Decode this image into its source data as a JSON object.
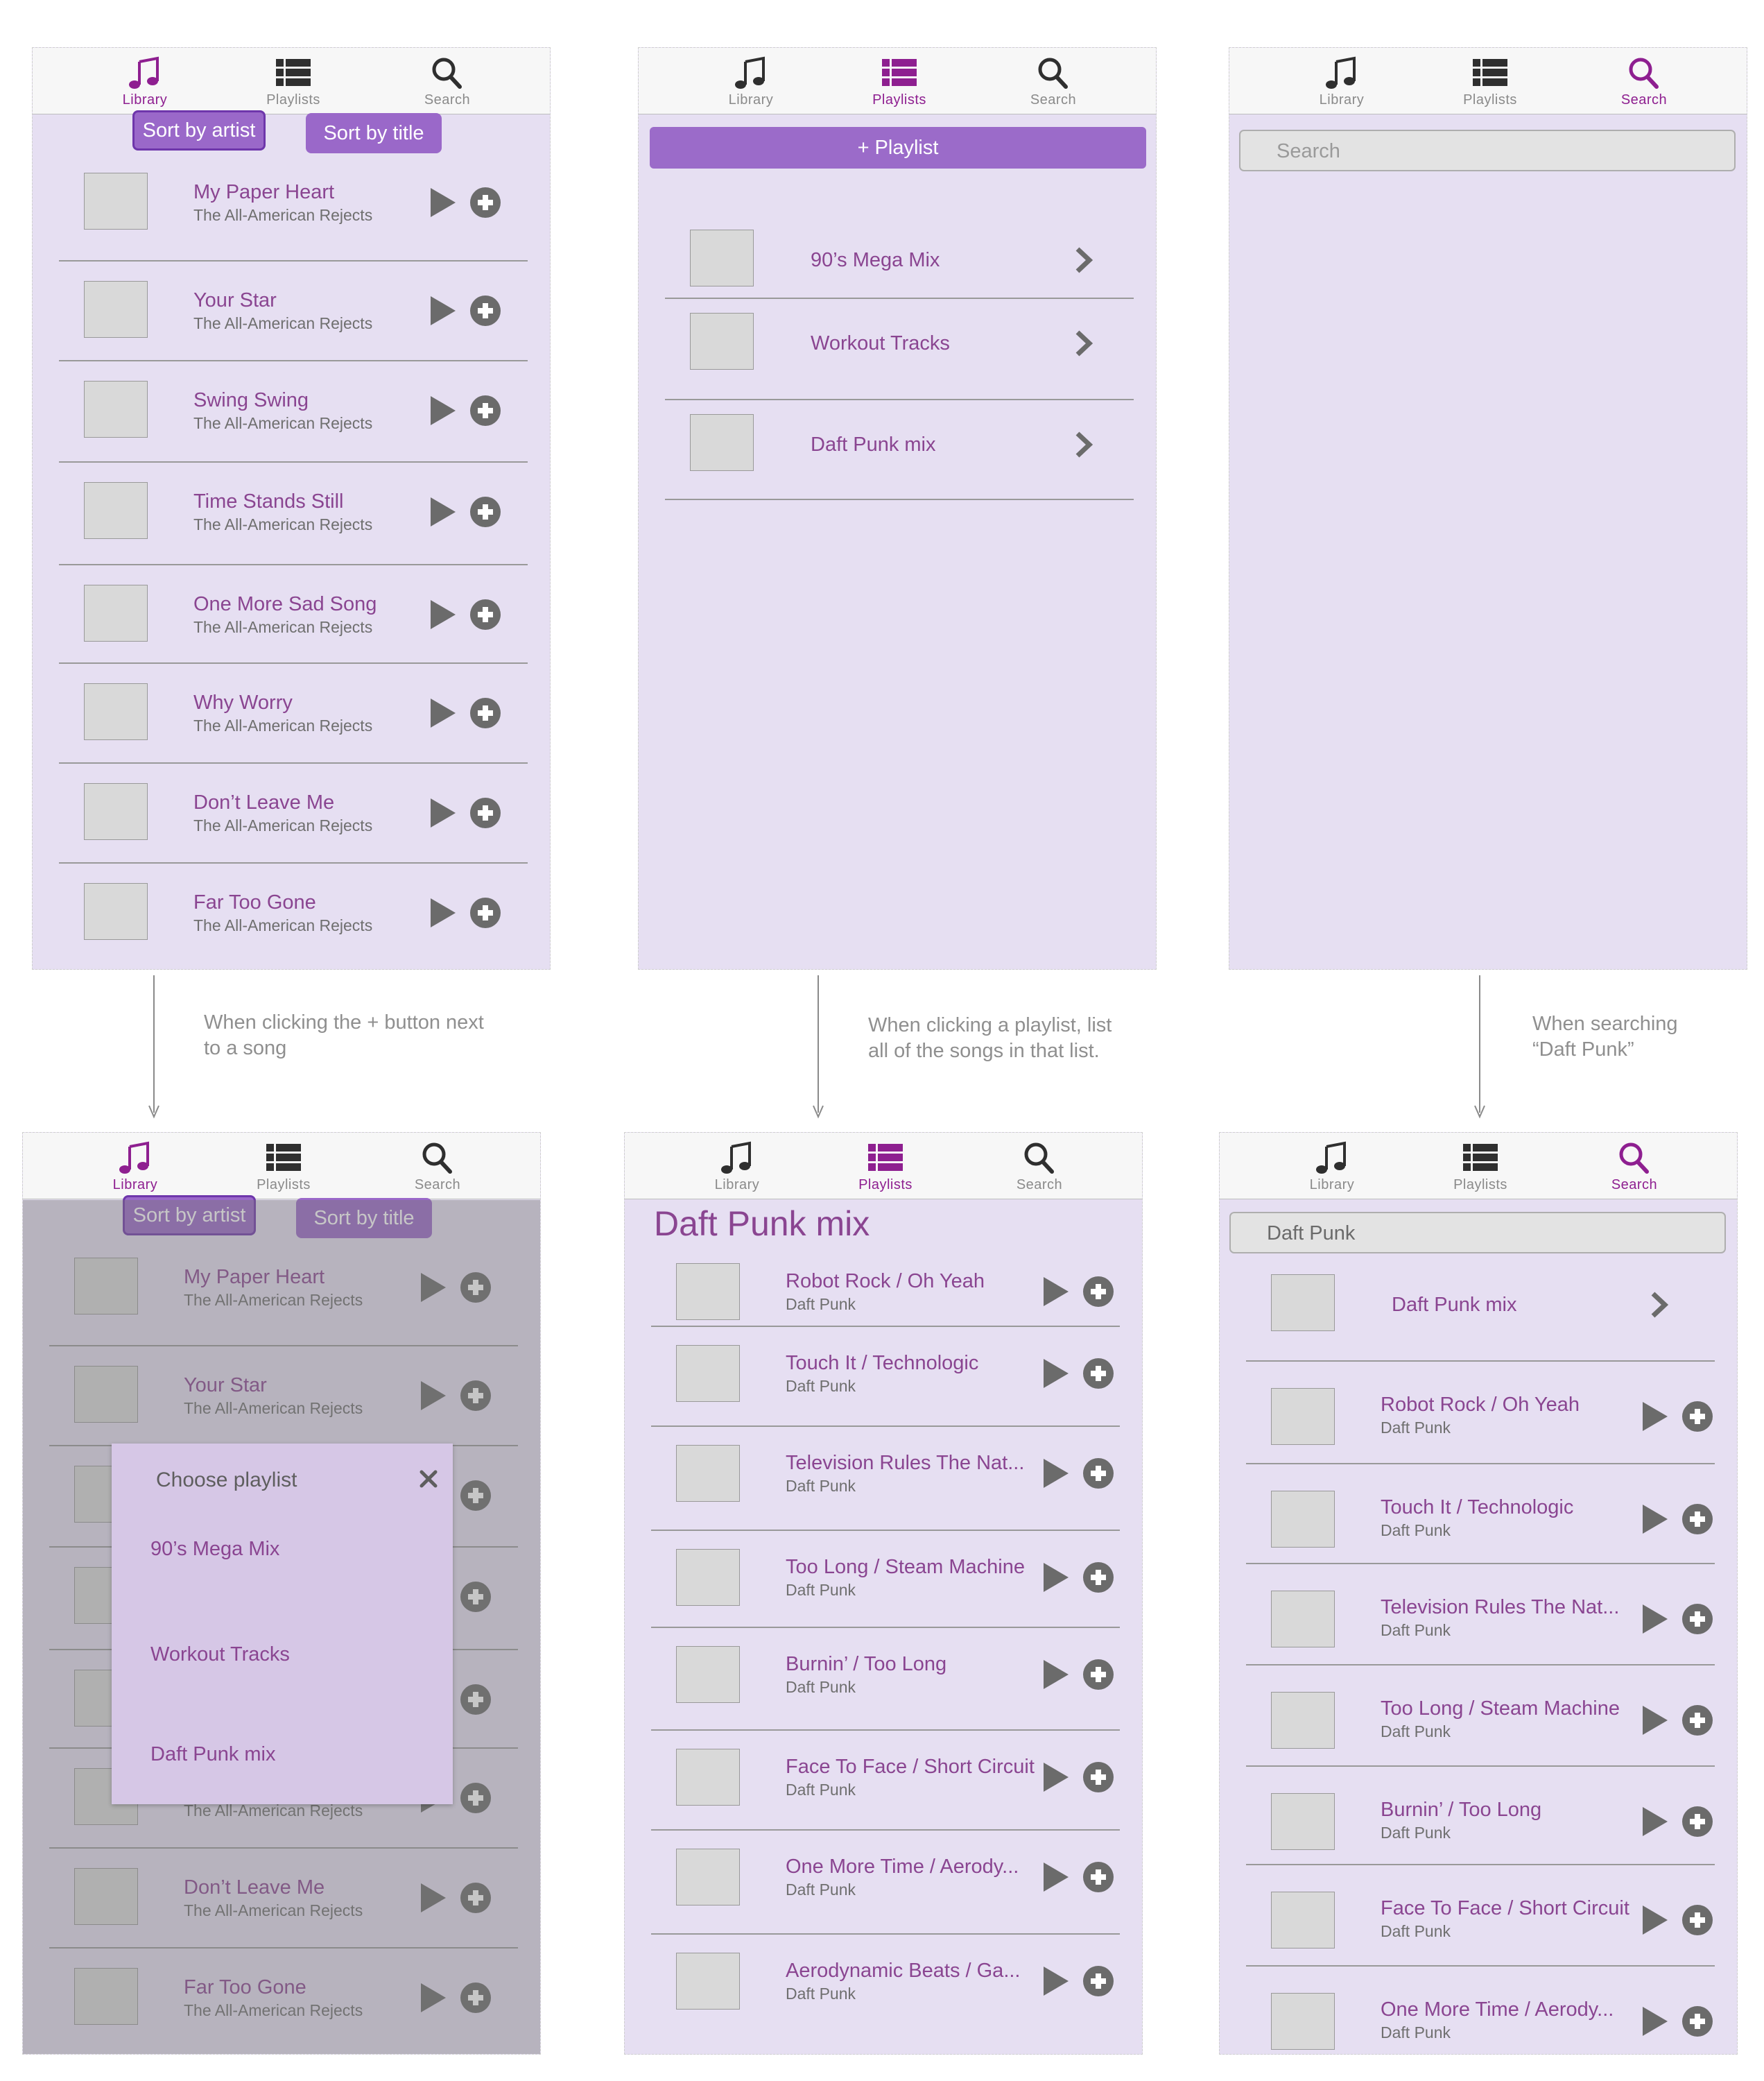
{
  "tabs": {
    "library": "Library",
    "playlists": "Playlists",
    "search": "Search"
  },
  "library": {
    "sort_artist": "Sort by artist",
    "sort_title": "Sort by title",
    "songs": [
      {
        "title": "My Paper Heart",
        "artist": "The All-American Rejects"
      },
      {
        "title": "Your Star",
        "artist": "The All-American Rejects"
      },
      {
        "title": "Swing Swing",
        "artist": "The All-American Rejects"
      },
      {
        "title": "Time Stands Still",
        "artist": "The All-American Rejects"
      },
      {
        "title": "One More Sad Song",
        "artist": "The All-American Rejects"
      },
      {
        "title": "Why Worry",
        "artist": "The All-American Rejects"
      },
      {
        "title": "Don’t Leave Me",
        "artist": "The All-American Rejects"
      },
      {
        "title": "Far Too Gone",
        "artist": "The All-American Rejects"
      }
    ]
  },
  "playlists": {
    "new_button": "+ Playlist",
    "items": [
      "90’s Mega Mix",
      "Workout Tracks",
      "Daft Punk mix"
    ]
  },
  "search": {
    "placeholder": "Search",
    "query": "Daft Punk"
  },
  "captions": {
    "add_song": "When clicking the + button next to a song",
    "open_playlist": "When clicking a playlist, list all of the songs in that list.",
    "searching": "When searching “Daft Punk”"
  },
  "modal": {
    "title": "Choose playlist",
    "items": [
      "90’s Mega Mix",
      "Workout Tracks",
      "Daft Punk mix"
    ]
  },
  "playlist_detail": {
    "heading": "Daft Punk mix",
    "songs": [
      {
        "title": "Robot Rock / Oh Yeah",
        "artist": "Daft Punk"
      },
      {
        "title": "Touch It / Technologic",
        "artist": "Daft Punk"
      },
      {
        "title": "Television Rules The Nat...",
        "artist": "Daft Punk"
      },
      {
        "title": "Too Long / Steam Machine",
        "artist": "Daft Punk"
      },
      {
        "title": "Burnin’ / Too Long",
        "artist": "Daft Punk"
      },
      {
        "title": "Face To Face / Short Circuit",
        "artist": "Daft Punk"
      },
      {
        "title": "One More Time / Aerody...",
        "artist": "Daft Punk"
      },
      {
        "title": "Aerodynamic Beats / Ga...",
        "artist": "Daft Punk"
      }
    ]
  },
  "search_results": {
    "playlist": "Daft Punk mix",
    "songs": [
      {
        "title": "Robot Rock / Oh Yeah",
        "artist": "Daft Punk"
      },
      {
        "title": "Touch It / Technologic",
        "artist": "Daft Punk"
      },
      {
        "title": "Television Rules The Nat...",
        "artist": "Daft Punk"
      },
      {
        "title": "Too Long / Steam Machine",
        "artist": "Daft Punk"
      },
      {
        "title": "Burnin’ / Too Long",
        "artist": "Daft Punk"
      },
      {
        "title": "Face To Face / Short Circuit",
        "artist": "Daft Punk"
      },
      {
        "title": "One More Time / Aerody...",
        "artist": "Daft Punk"
      }
    ]
  },
  "colors": {
    "screen_bg": "#e6dff2",
    "accent": "#9a68c9",
    "active_tab": "#8e1f90",
    "text_purple": "#8a4591",
    "icon_gray": "#6b6b6b"
  }
}
